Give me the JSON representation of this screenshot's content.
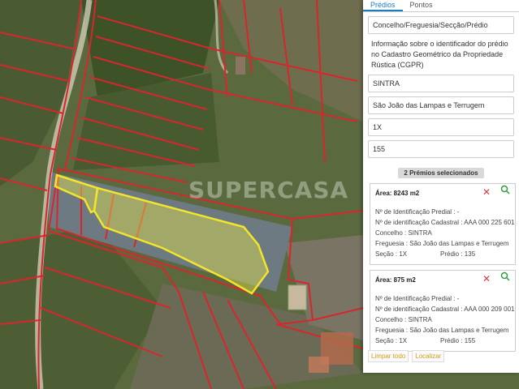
{
  "map": {
    "watermark": "SUPERCASA",
    "colors": {
      "boundary": "#d8262c",
      "selection": "#f2e52a",
      "selection_fill": "#e0e04a"
    }
  },
  "panel": {
    "tabs": [
      {
        "label": "Prédios",
        "active": true
      },
      {
        "label": "Pontos",
        "active": false
      }
    ],
    "search_mode": "Concelho/Freguesia/Secção/Prédio",
    "info_text": "Informação sobre o identificador do prédio no Cadastro Geométrico da Propriedade Rústica (CGPR)",
    "concelho": "SINTRA",
    "freguesia": "São João das Lampas e Terrugem",
    "seccao": "1X",
    "predio": "155",
    "selected_header": "2 Prémios selecionados",
    "cards": [
      {
        "area": "Área: 8243 m2",
        "predial": "Nº de Identificação Predial : -",
        "cadastral": "Nº de identificação Cadastral : AAA 000 225 601",
        "concelho": "Concelho : SINTRA",
        "freguesia": "Freguesia : São João das Lampas e Terrugem",
        "seccao": "Seção : 1X",
        "predio": "Prédio : 135"
      },
      {
        "area": "Área: 875 m2",
        "predial": "Nº de Identificação Predial : -",
        "cadastral": "Nº de identificação Cadastral : AAA 000 209 001",
        "concelho": "Concelho : SINTRA",
        "freguesia": "Freguesia : São João das Lampas e Terrugem",
        "seccao": "Seção : 1X",
        "predio": "Prédio : 155"
      }
    ],
    "footer": {
      "clear": "Limpar todo",
      "locate": "Localizar"
    }
  }
}
